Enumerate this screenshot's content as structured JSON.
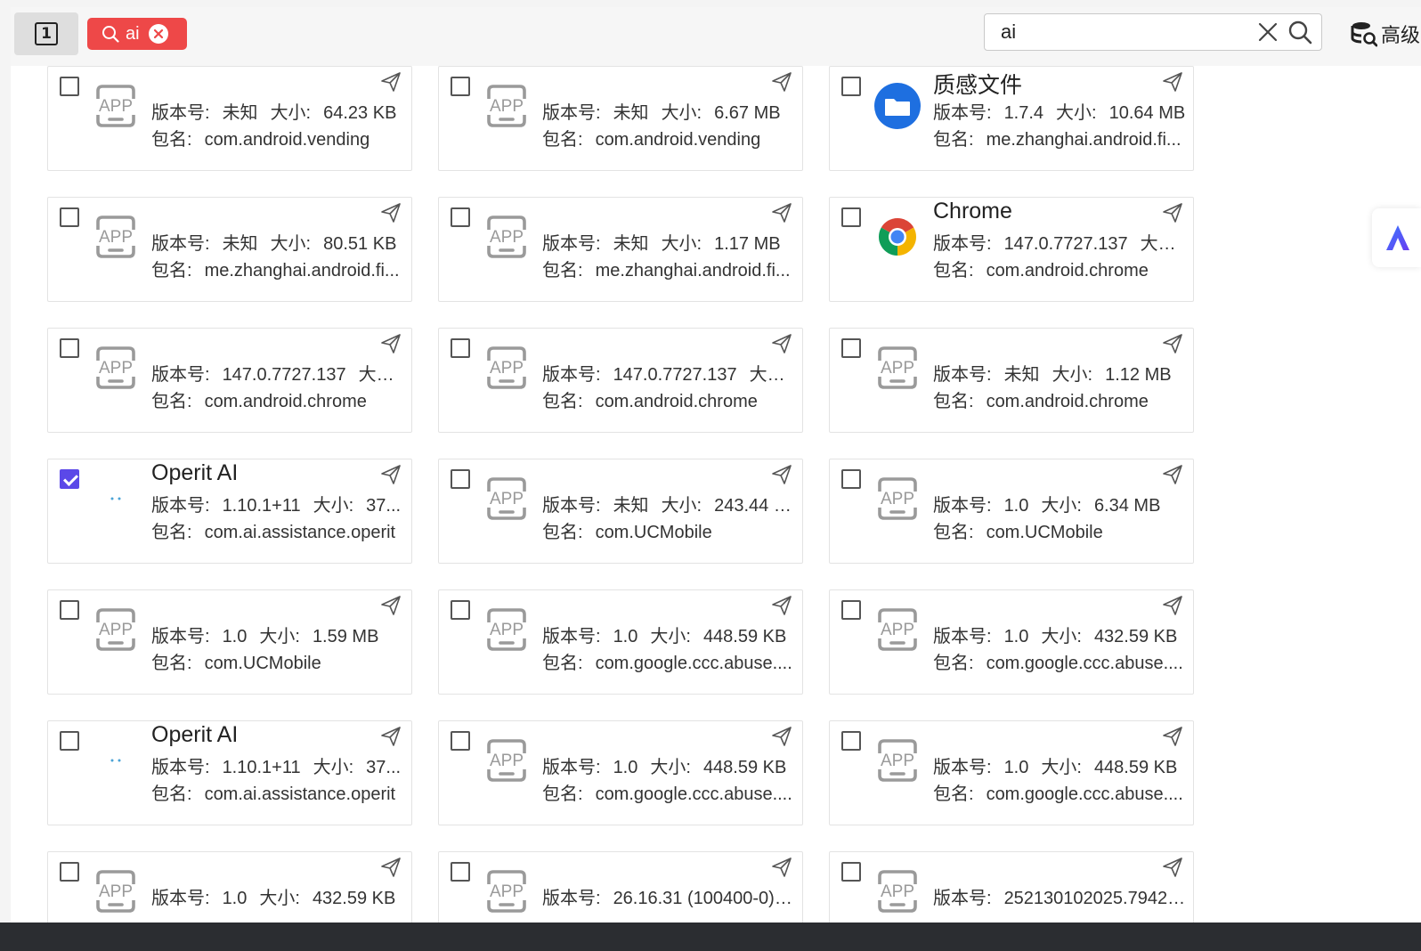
{
  "toolbar": {
    "page_number": "1",
    "filter_tag": "ai",
    "search_value": "ai",
    "search_placeholder": "",
    "advanced_label": "高级"
  },
  "colors": {
    "tag_red": "#ee4848",
    "checkbox_checked": "#5b48e8",
    "folder_blue": "#1e6fe0"
  },
  "labels": {
    "version": "版本号:",
    "size": "大小:",
    "package": "包名:"
  },
  "cards": [
    {
      "checked": false,
      "icon": "app-placeholder-icon",
      "title": "",
      "version": "未知",
      "size": "64.23 KB",
      "package": "com.android.vending"
    },
    {
      "checked": false,
      "icon": "app-placeholder-icon",
      "title": "",
      "version": "未知",
      "size": "6.67 MB",
      "package": "com.android.vending"
    },
    {
      "checked": false,
      "icon": "folder-icon",
      "title": "质感文件",
      "version": "1.7.4",
      "size": "10.64 MB",
      "package": "me.zhanghai.android.fi..."
    },
    {
      "checked": false,
      "icon": "app-placeholder-icon",
      "title": "",
      "version": "未知",
      "size": "80.51 KB",
      "package": "me.zhanghai.android.fi..."
    },
    {
      "checked": false,
      "icon": "app-placeholder-icon",
      "title": "",
      "version": "未知",
      "size": "1.17 MB",
      "package": "me.zhanghai.android.fi..."
    },
    {
      "checked": false,
      "icon": "chrome-icon",
      "title": "Chrome",
      "version": "147.0.7727.137",
      "size": "大小...",
      "package": "com.android.chrome"
    },
    {
      "checked": false,
      "icon": "app-placeholder-icon",
      "title": "",
      "version": "147.0.7727.137",
      "size": "大小...",
      "package": "com.android.chrome"
    },
    {
      "checked": false,
      "icon": "app-placeholder-icon",
      "title": "",
      "version": "147.0.7727.137",
      "size": "大小...",
      "package": "com.android.chrome"
    },
    {
      "checked": false,
      "icon": "app-placeholder-icon",
      "title": "",
      "version": "未知",
      "size": "1.12 MB",
      "package": "com.android.chrome"
    },
    {
      "checked": true,
      "icon": "operit-icon",
      "title": "Operit AI",
      "version": "1.10.1+11",
      "size": "37...",
      "package": "com.ai.assistance.operit"
    },
    {
      "checked": false,
      "icon": "app-placeholder-icon",
      "title": "",
      "version": "未知",
      "size": "243.44 KB",
      "package": "com.UCMobile"
    },
    {
      "checked": false,
      "icon": "app-placeholder-icon",
      "title": "",
      "version": "1.0",
      "size": "6.34 MB",
      "package": "com.UCMobile"
    },
    {
      "checked": false,
      "icon": "app-placeholder-icon",
      "title": "",
      "version": "1.0",
      "size": "1.59 MB",
      "package": "com.UCMobile"
    },
    {
      "checked": false,
      "icon": "app-placeholder-icon",
      "title": "",
      "version": "1.0",
      "size": "448.59 KB",
      "package": "com.google.ccc.abuse...."
    },
    {
      "checked": false,
      "icon": "app-placeholder-icon",
      "title": "",
      "version": "1.0",
      "size": "432.59 KB",
      "package": "com.google.ccc.abuse...."
    },
    {
      "checked": false,
      "icon": "operit-icon",
      "title": "Operit AI",
      "version": "1.10.1+11",
      "size": "37...",
      "package": "com.ai.assistance.operit"
    },
    {
      "checked": false,
      "icon": "app-placeholder-icon",
      "title": "",
      "version": "1.0",
      "size": "448.59 KB",
      "package": "com.google.ccc.abuse...."
    },
    {
      "checked": false,
      "icon": "app-placeholder-icon",
      "title": "",
      "version": "1.0",
      "size": "448.59 KB",
      "package": "com.google.ccc.abuse...."
    },
    {
      "checked": false,
      "icon": "app-placeholder-icon",
      "title": "",
      "version": "1.0",
      "size": "432.59 KB",
      "package": ""
    },
    {
      "checked": false,
      "icon": "app-placeholder-icon",
      "title": "",
      "version": "26.16.31 (100400-0)...",
      "size": "",
      "package": ""
    },
    {
      "checked": false,
      "icon": "app-placeholder-icon",
      "title": "",
      "version": "252130102025.7942...",
      "size": "",
      "package": ""
    }
  ]
}
